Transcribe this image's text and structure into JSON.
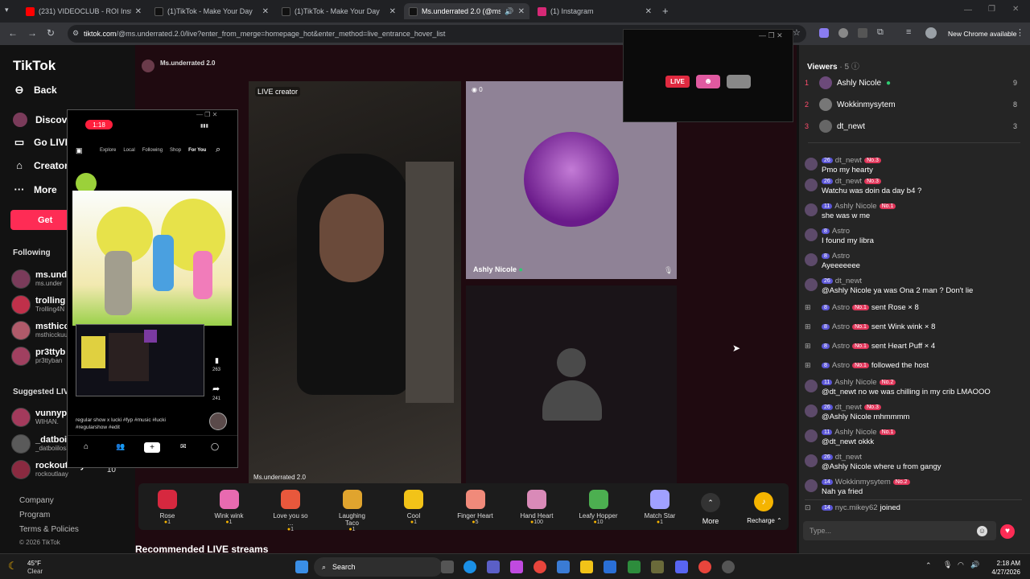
{
  "tabs": [
    {
      "label": "(231) VIDEOCLUB - ROI Instrum",
      "color": "#ff0000"
    },
    {
      "label": "(1)TikTok - Make Your Day",
      "color": "#111111"
    },
    {
      "label": "(1)TikTok - Make Your Day",
      "color": "#111111"
    },
    {
      "label": "Ms.underrated 2.0 (@ms.u",
      "color": "#111111"
    },
    {
      "label": "(1) Instagram",
      "color": "#d62976"
    }
  ],
  "address": {
    "domain": "tiktok.com",
    "path": "/@ms.underrated.2.0/live?enter_from_merge=homepage_hot&enter_method=live_entrance_hover_list"
  },
  "browser": {
    "chrome_notice": "New Chrome available"
  },
  "sidebar": {
    "logo": "TikTok",
    "back": "Back",
    "items": [
      "Discover",
      "Go LIVE",
      "Creator",
      "More"
    ],
    "get_button": "Get",
    "following_title": "Following",
    "following": [
      {
        "name": "ms.unde",
        "handle": "ms.under"
      },
      {
        "name": "trolling",
        "handle": "Trolling4N"
      },
      {
        "name": "msthicc",
        "handle": "msthicckuu"
      },
      {
        "name": "pr3ttyb",
        "handle": "pr3ttyban"
      }
    ],
    "suggested_title": "Suggested LIVE",
    "suggested": [
      {
        "name": "vunnyp",
        "handle": "WIHAN.",
        "count": ""
      },
      {
        "name": "_datboiilos",
        "handle": "_datboiilos360",
        "count": "6"
      },
      {
        "name": "rockoutlaay",
        "handle": "rockoutlaay",
        "count": "10"
      }
    ],
    "footer": [
      "Company",
      "Program",
      "Terms & Policies"
    ],
    "copyright": "© 2026 TikTok"
  },
  "stream": {
    "host": "Ms.underrated 2.0",
    "live_creator": "LIVE creator",
    "host_label": "Ms.underrated 2.0",
    "guest_name": "Ashly Nicole",
    "guest_count": "0",
    "recommended": "Recommended LIVE streams"
  },
  "phone": {
    "time": "1:18",
    "tabs": [
      "Explore",
      "Local",
      "Following",
      "Shop",
      "For You"
    ],
    "caption": "regular show x lucki #fyp #music #lucki #regularshow #edit",
    "likes": "263",
    "shares": "241"
  },
  "gifts": [
    {
      "name": "Rose",
      "price": "1",
      "color": "#d6283f"
    },
    {
      "name": "Wink wink",
      "price": "1",
      "color": "#e86ab0"
    },
    {
      "name": "Love you so ...",
      "price": "1",
      "color": "#e8583c"
    },
    {
      "name": "Laughing Taco",
      "price": "1",
      "color": "#e0a42e"
    },
    {
      "name": "Cool",
      "price": "1",
      "color": "#f2c318"
    },
    {
      "name": "Finger Heart",
      "price": "5",
      "color": "#f08a7a"
    },
    {
      "name": "Hand Heart",
      "price": "100",
      "color": "#d98ab8"
    },
    {
      "name": "Leafy Hopper",
      "price": "10",
      "color": "#4caf50"
    },
    {
      "name": "Match Star",
      "price": "1",
      "color": "#a0a0ff"
    }
  ],
  "gift_more": "More",
  "recharge": "Recharge",
  "viewers": {
    "title": "Viewers",
    "count": "5",
    "list": [
      {
        "rank": "1",
        "name": "Ashly Nicole",
        "score": "9"
      },
      {
        "rank": "2",
        "name": "Wokkinmysytem",
        "score": "8"
      },
      {
        "rank": "3",
        "name": "dt_newt",
        "score": "3"
      }
    ]
  },
  "messages": [
    {
      "lvl": "26",
      "name": "dt_newt",
      "badge": "No.3",
      "text": "Pmo my hearty"
    },
    {
      "lvl": "26",
      "name": "dt_newt",
      "badge": "No.3",
      "text": "Watchu was doin da day b4 ?"
    },
    {
      "lvl": "11",
      "name": "Ashly Nicole",
      "badge": "No.1",
      "text": "she was w me"
    },
    {
      "lvl": "8",
      "name": "Astro",
      "badge": "",
      "text": "I found my libra"
    },
    {
      "lvl": "8",
      "name": "Astro",
      "badge": "",
      "text": "Ayeeeeeee"
    },
    {
      "lvl": "26",
      "name": "dt_newt",
      "badge": "",
      "text": "@Ashly Nicole ya was Ona 2 man ? Don't lie"
    }
  ],
  "events": [
    {
      "lvl": "8",
      "name": "Astro",
      "badge": "No.1",
      "text": "sent Rose × 8"
    },
    {
      "lvl": "8",
      "name": "Astro",
      "badge": "No.1",
      "text": "sent Wink wink × 8"
    },
    {
      "lvl": "8",
      "name": "Astro",
      "badge": "No.1",
      "text": "sent Heart Puff × 4"
    },
    {
      "lvl": "8",
      "name": "Astro",
      "badge": "No.1",
      "text": "followed the host"
    }
  ],
  "messages2": [
    {
      "lvl": "11",
      "name": "Ashly Nicole",
      "badge": "No.2",
      "text": "@dt_newt no we was chilling in my crib LMAOOO"
    },
    {
      "lvl": "26",
      "name": "dt_newt",
      "badge": "No.3",
      "text": "@Ashly Nicole mhmmmm"
    },
    {
      "lvl": "11",
      "name": "Ashly Nicole",
      "badge": "No.1",
      "text": "@dt_newt okkk"
    },
    {
      "lvl": "26",
      "name": "dt_newt",
      "badge": "",
      "text": "@Ashly Nicole where u from gangy"
    },
    {
      "lvl": "14",
      "name": "Wokkinmysytem",
      "badge": "No.2",
      "text": "Nah ya fried"
    }
  ],
  "joined": {
    "lvl": "14",
    "name": "nyc.mikey62",
    "text": "joined"
  },
  "chat_input": {
    "placeholder": "Type..."
  },
  "overlay_window": {
    "live": "LIVE"
  },
  "taskbar": {
    "weather_temp": "45°F",
    "weather_desc": "Clear",
    "search": "Search",
    "time": "2:18 AM",
    "date": "4/27/2026"
  }
}
